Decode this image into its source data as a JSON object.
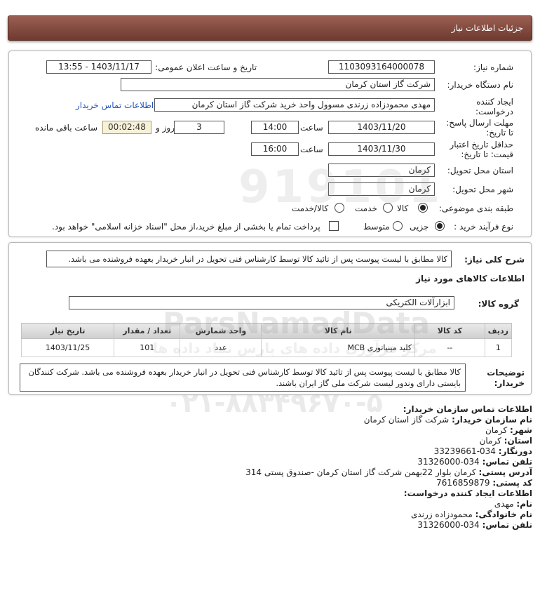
{
  "header": {
    "title": "جزئیات اطلاعات نیاز"
  },
  "form": {
    "need_number_label": "شماره نیاز:",
    "need_number": "1103093164000078",
    "announce_label": "تاریخ و ساعت اعلان عمومی:",
    "announce_value": "1403/11/17 - 13:55",
    "buyer_org_label": "نام دستگاه خریدار:",
    "buyer_org": "شرکت گاز استان کرمان",
    "requester_label": "ایجاد کننده درخواست:",
    "requester": "مهدی محمودزاده زرندی مسوول واحد خرید شرکت گاز استان کرمان",
    "contact_link": "اطلاعات تماس خریدار",
    "deadline_label": "مهلت ارسال پاسخ: تا تاریخ:",
    "deadline_date": "1403/11/20",
    "time_label": "ساعت",
    "deadline_time": "14:00",
    "days_value": "3",
    "days_label": "روز و",
    "remaining_time": "00:02:48",
    "remaining_label": "ساعت باقی مانده",
    "validity_label": "حداقل تاریخ اعتبار قیمت: تا تاریخ:",
    "validity_date": "1403/11/30",
    "validity_time": "16:00",
    "province_label": "استان محل تحویل:",
    "province": "کرمان",
    "city_label": "شهر محل تحویل:",
    "city": "کرمان",
    "category_label": "طبقه بندی موضوعی:",
    "category_options": [
      "کالا",
      "خدمت",
      "کالا/خدمت"
    ],
    "category_selected": "کالا",
    "process_label": "نوع فرآیند خرید :",
    "process_options": [
      "جزیی",
      "متوسط"
    ],
    "process_selected": "جزیی",
    "payment_text": "پرداخت تمام یا بخشی از مبلغ خرید،از محل \"اسناد خزانه اسلامی\" خواهد بود."
  },
  "need": {
    "desc_label": "شرح کلی نیاز:",
    "desc_value": "کالا مطابق با لیست پیوست پس از تائید کالا توسط کارشناس فنی تحویل در انبار خریدار بعهده فروشنده می باشد.",
    "goods_info_title": "اطلاعات کالاهای مورد نیاز",
    "group_label": "گروه کالا:",
    "group_value": "ابزارآلات الکتریکی"
  },
  "table": {
    "headers": [
      "ردیف",
      "کد کالا",
      "نام کالا",
      "واحد شمارش",
      "تعداد / مقدار",
      "تاریخ نیاز"
    ],
    "rows": [
      [
        "1",
        "--",
        "کلید مینیاتوری MCB",
        "عدد",
        "101",
        "1403/11/25"
      ]
    ]
  },
  "buyer_notes": {
    "label": "توضیحات خریدار:",
    "text": "کالا مطابق با لیست پیوست پس از تائید کالا توسط کارشناس فنی تحویل در انبار خریدار بعهده فروشنده می باشد. شرکت کنندگان بایستی دارای وندور لیست شرکت ملی گاز ایران باشند."
  },
  "contact": {
    "title": "اطلاعات تماس سازمان خریدار:",
    "org_label": "نام سازمان خریدار:",
    "org": "شرکت گاز استان کرمان",
    "city_label": "شهر:",
    "city": "کرمان",
    "province_label": "استان:",
    "province": "کرمان",
    "fax_label": "دورنگار:",
    "fax": "034-33239661",
    "phone_label": "تلفن تماس:",
    "phone": "034-31326000",
    "address_label": "آدرس پستی:",
    "address": "کرمان بلوار 22بهمن شرکت گاز استان کرمان -صندوق پستی 314",
    "postal_label": "کد پستی:",
    "postal": "7616859879",
    "creator_title": "اطلاعات ایجاد کننده درخواست:",
    "name_label": "نام:",
    "name": "مهدی",
    "family_label": "نام خانوادگی:",
    "family": "محمودزاده زرندی",
    "creator_phone_label": "تلفن تماس:",
    "creator_phone": "034-31326000"
  },
  "watermark": {
    "line1": "ParsNamadData",
    "line2": "مرکز فرآوری داده های پارس نماد داده ها",
    "line3": "۰۲۱-۸۸۳۴۹۶۷۰-۵",
    "big": "919101"
  }
}
